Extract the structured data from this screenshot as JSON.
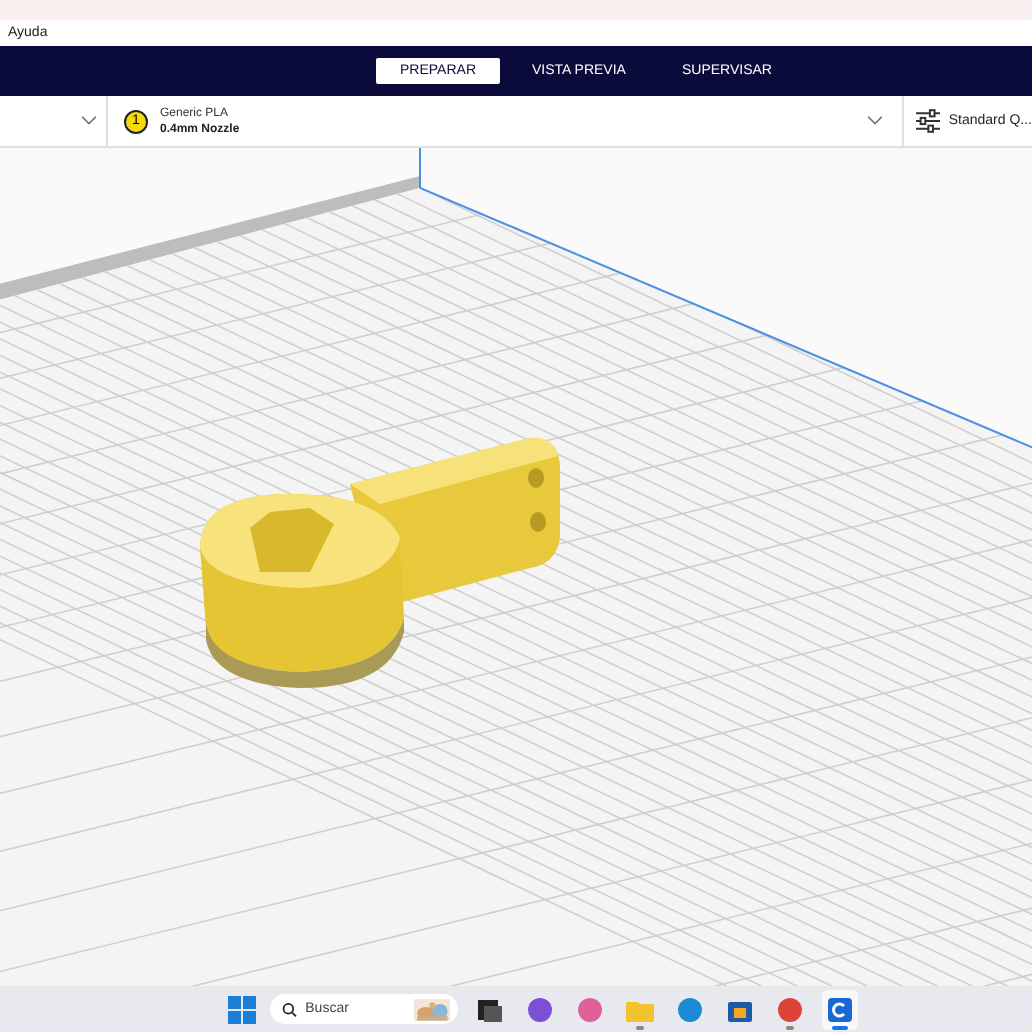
{
  "menu_bar": {
    "items": [
      "Ayuda"
    ]
  },
  "stage_tabs": [
    {
      "label": "PREPARAR",
      "selected": true
    },
    {
      "label": "VISTA PREVIA",
      "selected": false
    },
    {
      "label": "SUPERVISAR",
      "selected": false
    }
  ],
  "toolbar": {
    "extruder_number": "1",
    "material": "Generic PLA",
    "nozzle": "0.4mm Nozzle",
    "profile": "Standard Q..."
  },
  "taskbar": {
    "search": {
      "placeholder": "Buscar"
    },
    "apps": [
      {
        "kind": "terminal",
        "running": false,
        "selected": false
      },
      {
        "kind": "chat",
        "running": false,
        "selected": false
      },
      {
        "kind": "copilot",
        "running": false,
        "selected": false
      },
      {
        "kind": "folder",
        "running": true,
        "selected": false
      },
      {
        "kind": "edge",
        "running": false,
        "selected": false
      },
      {
        "kind": "store",
        "running": false,
        "selected": false
      },
      {
        "kind": "chrome",
        "running": true,
        "selected": false
      },
      {
        "kind": "cura",
        "running": true,
        "selected": true
      }
    ]
  }
}
